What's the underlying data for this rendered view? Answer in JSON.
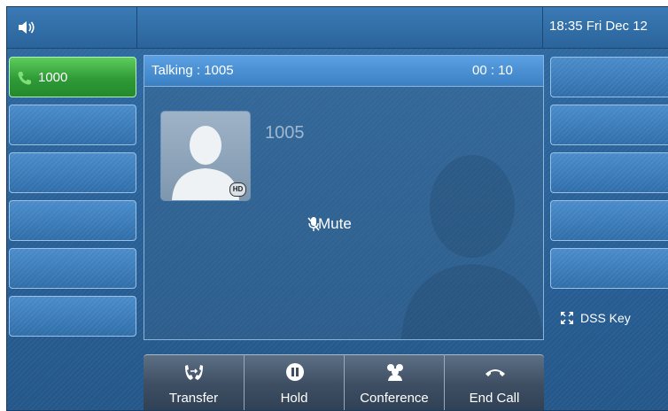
{
  "status_bar": {
    "speaker_icon": "speaker-icon",
    "clock": "18:35 Fri Dec 12"
  },
  "line_keys": [
    {
      "label": "1000",
      "icon": "phone-icon",
      "active": true
    },
    {
      "label": ""
    },
    {
      "label": ""
    },
    {
      "label": ""
    },
    {
      "label": ""
    },
    {
      "label": ""
    }
  ],
  "call": {
    "status": "Talking : 1005",
    "timer": "00 : 10",
    "callee": "1005",
    "hd_badge": "HD",
    "mute_label": "Mute"
  },
  "right_keys": {
    "dss_label": "DSS Key"
  },
  "softkeys": [
    {
      "label": "Transfer",
      "icon": "transfer-icon"
    },
    {
      "label": "Hold",
      "icon": "hold-icon"
    },
    {
      "label": "Conference",
      "icon": "conference-icon"
    },
    {
      "label": "End Call",
      "icon": "end-call-icon"
    }
  ],
  "colors": {
    "active_line": "#3aa83f",
    "header": "#4a90d4",
    "background": "#2a6299"
  }
}
